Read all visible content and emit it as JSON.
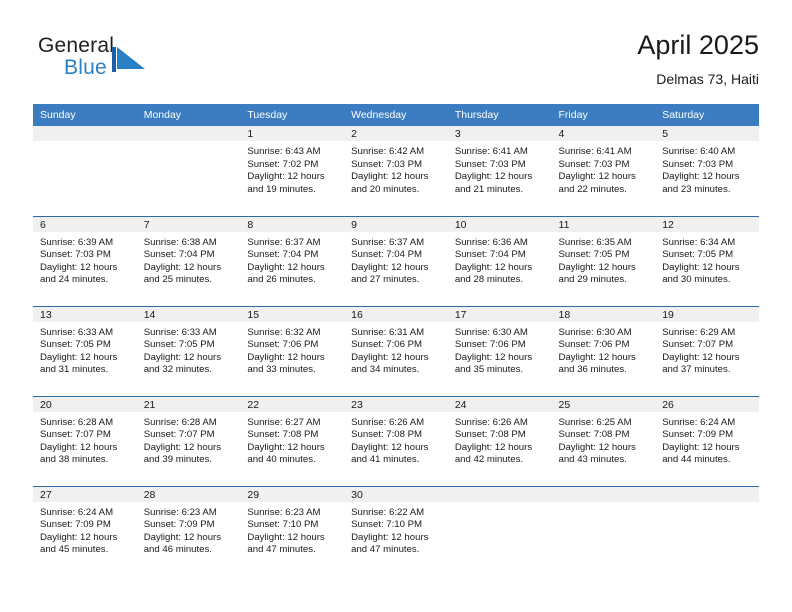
{
  "brand": {
    "name_part1": "General",
    "name_part2": "Blue",
    "flag_icon": "blue-triangle-flag-icon",
    "accent_color": "#2980c4"
  },
  "header": {
    "title": "April 2025",
    "subtitle": "Delmas 73, Haiti"
  },
  "theme": {
    "header_blue": "#3b7dc0",
    "row_border_blue": "#2e6ca8",
    "daynum_band": "#f0f0f0"
  },
  "weekdays": [
    "Sunday",
    "Monday",
    "Tuesday",
    "Wednesday",
    "Thursday",
    "Friday",
    "Saturday"
  ],
  "weeks": [
    [
      {
        "day": "",
        "lines": []
      },
      {
        "day": "",
        "lines": []
      },
      {
        "day": "1",
        "lines": [
          "Sunrise: 6:43 AM",
          "Sunset: 7:02 PM",
          "Daylight: 12 hours",
          "and 19 minutes."
        ]
      },
      {
        "day": "2",
        "lines": [
          "Sunrise: 6:42 AM",
          "Sunset: 7:03 PM",
          "Daylight: 12 hours",
          "and 20 minutes."
        ]
      },
      {
        "day": "3",
        "lines": [
          "Sunrise: 6:41 AM",
          "Sunset: 7:03 PM",
          "Daylight: 12 hours",
          "and 21 minutes."
        ]
      },
      {
        "day": "4",
        "lines": [
          "Sunrise: 6:41 AM",
          "Sunset: 7:03 PM",
          "Daylight: 12 hours",
          "and 22 minutes."
        ]
      },
      {
        "day": "5",
        "lines": [
          "Sunrise: 6:40 AM",
          "Sunset: 7:03 PM",
          "Daylight: 12 hours",
          "and 23 minutes."
        ]
      }
    ],
    [
      {
        "day": "6",
        "lines": [
          "Sunrise: 6:39 AM",
          "Sunset: 7:03 PM",
          "Daylight: 12 hours",
          "and 24 minutes."
        ]
      },
      {
        "day": "7",
        "lines": [
          "Sunrise: 6:38 AM",
          "Sunset: 7:04 PM",
          "Daylight: 12 hours",
          "and 25 minutes."
        ]
      },
      {
        "day": "8",
        "lines": [
          "Sunrise: 6:37 AM",
          "Sunset: 7:04 PM",
          "Daylight: 12 hours",
          "and 26 minutes."
        ]
      },
      {
        "day": "9",
        "lines": [
          "Sunrise: 6:37 AM",
          "Sunset: 7:04 PM",
          "Daylight: 12 hours",
          "and 27 minutes."
        ]
      },
      {
        "day": "10",
        "lines": [
          "Sunrise: 6:36 AM",
          "Sunset: 7:04 PM",
          "Daylight: 12 hours",
          "and 28 minutes."
        ]
      },
      {
        "day": "11",
        "lines": [
          "Sunrise: 6:35 AM",
          "Sunset: 7:05 PM",
          "Daylight: 12 hours",
          "and 29 minutes."
        ]
      },
      {
        "day": "12",
        "lines": [
          "Sunrise: 6:34 AM",
          "Sunset: 7:05 PM",
          "Daylight: 12 hours",
          "and 30 minutes."
        ]
      }
    ],
    [
      {
        "day": "13",
        "lines": [
          "Sunrise: 6:33 AM",
          "Sunset: 7:05 PM",
          "Daylight: 12 hours",
          "and 31 minutes."
        ]
      },
      {
        "day": "14",
        "lines": [
          "Sunrise: 6:33 AM",
          "Sunset: 7:05 PM",
          "Daylight: 12 hours",
          "and 32 minutes."
        ]
      },
      {
        "day": "15",
        "lines": [
          "Sunrise: 6:32 AM",
          "Sunset: 7:06 PM",
          "Daylight: 12 hours",
          "and 33 minutes."
        ]
      },
      {
        "day": "16",
        "lines": [
          "Sunrise: 6:31 AM",
          "Sunset: 7:06 PM",
          "Daylight: 12 hours",
          "and 34 minutes."
        ]
      },
      {
        "day": "17",
        "lines": [
          "Sunrise: 6:30 AM",
          "Sunset: 7:06 PM",
          "Daylight: 12 hours",
          "and 35 minutes."
        ]
      },
      {
        "day": "18",
        "lines": [
          "Sunrise: 6:30 AM",
          "Sunset: 7:06 PM",
          "Daylight: 12 hours",
          "and 36 minutes."
        ]
      },
      {
        "day": "19",
        "lines": [
          "Sunrise: 6:29 AM",
          "Sunset: 7:07 PM",
          "Daylight: 12 hours",
          "and 37 minutes."
        ]
      }
    ],
    [
      {
        "day": "20",
        "lines": [
          "Sunrise: 6:28 AM",
          "Sunset: 7:07 PM",
          "Daylight: 12 hours",
          "and 38 minutes."
        ]
      },
      {
        "day": "21",
        "lines": [
          "Sunrise: 6:28 AM",
          "Sunset: 7:07 PM",
          "Daylight: 12 hours",
          "and 39 minutes."
        ]
      },
      {
        "day": "22",
        "lines": [
          "Sunrise: 6:27 AM",
          "Sunset: 7:08 PM",
          "Daylight: 12 hours",
          "and 40 minutes."
        ]
      },
      {
        "day": "23",
        "lines": [
          "Sunrise: 6:26 AM",
          "Sunset: 7:08 PM",
          "Daylight: 12 hours",
          "and 41 minutes."
        ]
      },
      {
        "day": "24",
        "lines": [
          "Sunrise: 6:26 AM",
          "Sunset: 7:08 PM",
          "Daylight: 12 hours",
          "and 42 minutes."
        ]
      },
      {
        "day": "25",
        "lines": [
          "Sunrise: 6:25 AM",
          "Sunset: 7:08 PM",
          "Daylight: 12 hours",
          "and 43 minutes."
        ]
      },
      {
        "day": "26",
        "lines": [
          "Sunrise: 6:24 AM",
          "Sunset: 7:09 PM",
          "Daylight: 12 hours",
          "and 44 minutes."
        ]
      }
    ],
    [
      {
        "day": "27",
        "lines": [
          "Sunrise: 6:24 AM",
          "Sunset: 7:09 PM",
          "Daylight: 12 hours",
          "and 45 minutes."
        ]
      },
      {
        "day": "28",
        "lines": [
          "Sunrise: 6:23 AM",
          "Sunset: 7:09 PM",
          "Daylight: 12 hours",
          "and 46 minutes."
        ]
      },
      {
        "day": "29",
        "lines": [
          "Sunrise: 6:23 AM",
          "Sunset: 7:10 PM",
          "Daylight: 12 hours",
          "and 47 minutes."
        ]
      },
      {
        "day": "30",
        "lines": [
          "Sunrise: 6:22 AM",
          "Sunset: 7:10 PM",
          "Daylight: 12 hours",
          "and 47 minutes."
        ]
      },
      {
        "day": "",
        "lines": []
      },
      {
        "day": "",
        "lines": []
      },
      {
        "day": "",
        "lines": []
      }
    ]
  ]
}
